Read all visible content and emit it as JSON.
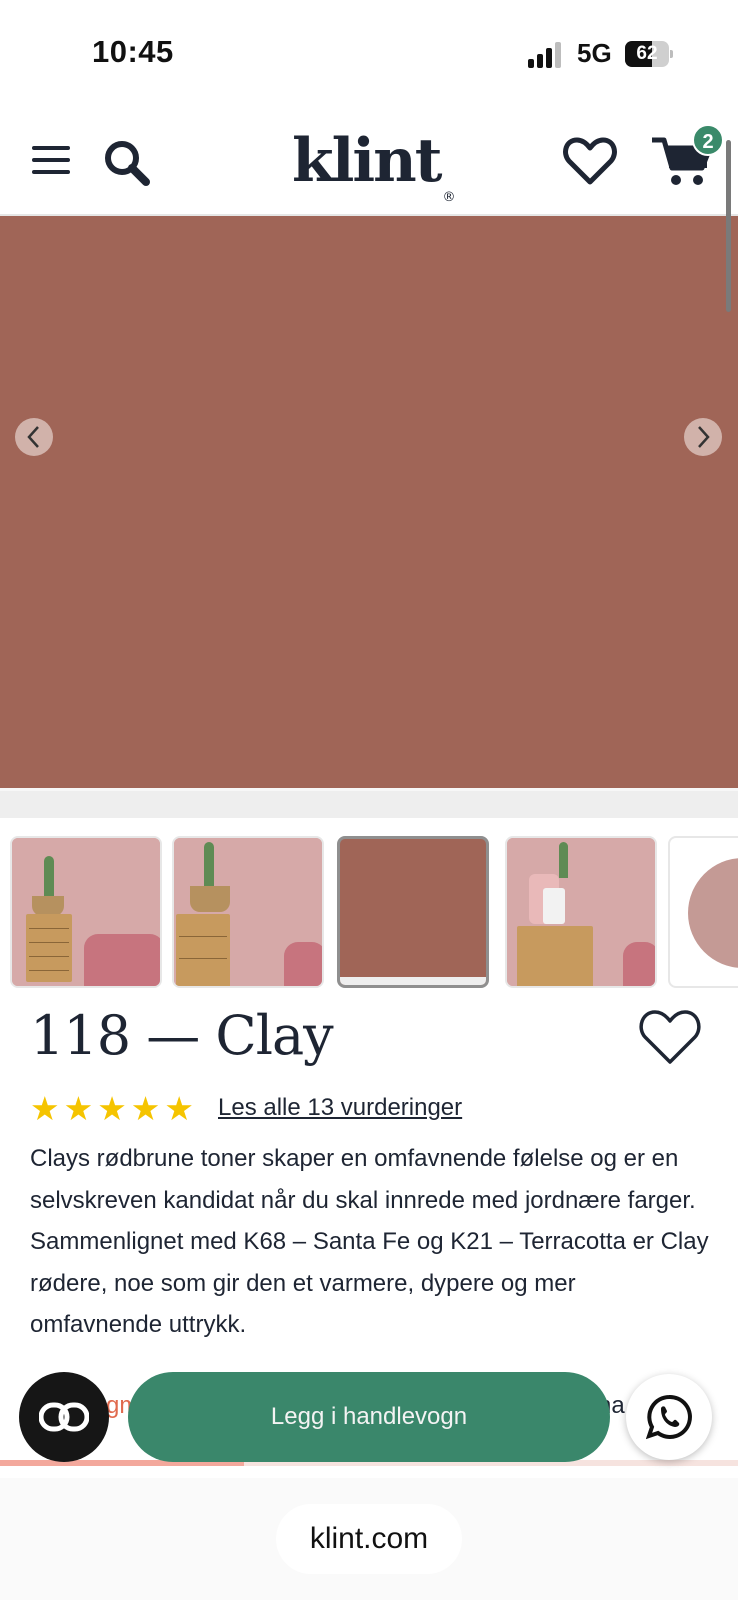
{
  "status_bar": {
    "time": "10:45",
    "network": "5G",
    "battery_level": "62",
    "battery_fraction": 0.62,
    "signal_bars": 3
  },
  "header": {
    "logo": "klint",
    "logo_mark": "®",
    "cart_count": "2"
  },
  "gallery": {
    "hero_color": "#a06557",
    "thumbnails": [
      "room-scene-1",
      "room-scene-2",
      "color-swatch-clay",
      "room-scene-3",
      "round-object"
    ],
    "active_index": 2
  },
  "product": {
    "title": "118 — Clay",
    "rating_stars": 5,
    "reviews_link": "Les alle 13 vurderinger",
    "description": "Clays rødbrune toner skaper en omfavnende følelse og er en selvskreven kandidat når du skal innrede med jordnære farger. Sammenlignet med K68 – Santa Fe og K21 – Terracotta er Clay rødere, noe som gir den et varmere, dypere og mer omfavnende uttrykk."
  },
  "bottom_bar": {
    "peek_left": "gm",
    "peek_right": "na",
    "add_to_cart": "Legg i handlevogn",
    "promo_progress": 0.33
  },
  "browser": {
    "url": "klint.com"
  },
  "colors": {
    "accent_green": "#3a876b",
    "badge_green": "#3a8a6a",
    "text_dark": "#1e2533",
    "star_yellow": "#f5c400"
  }
}
